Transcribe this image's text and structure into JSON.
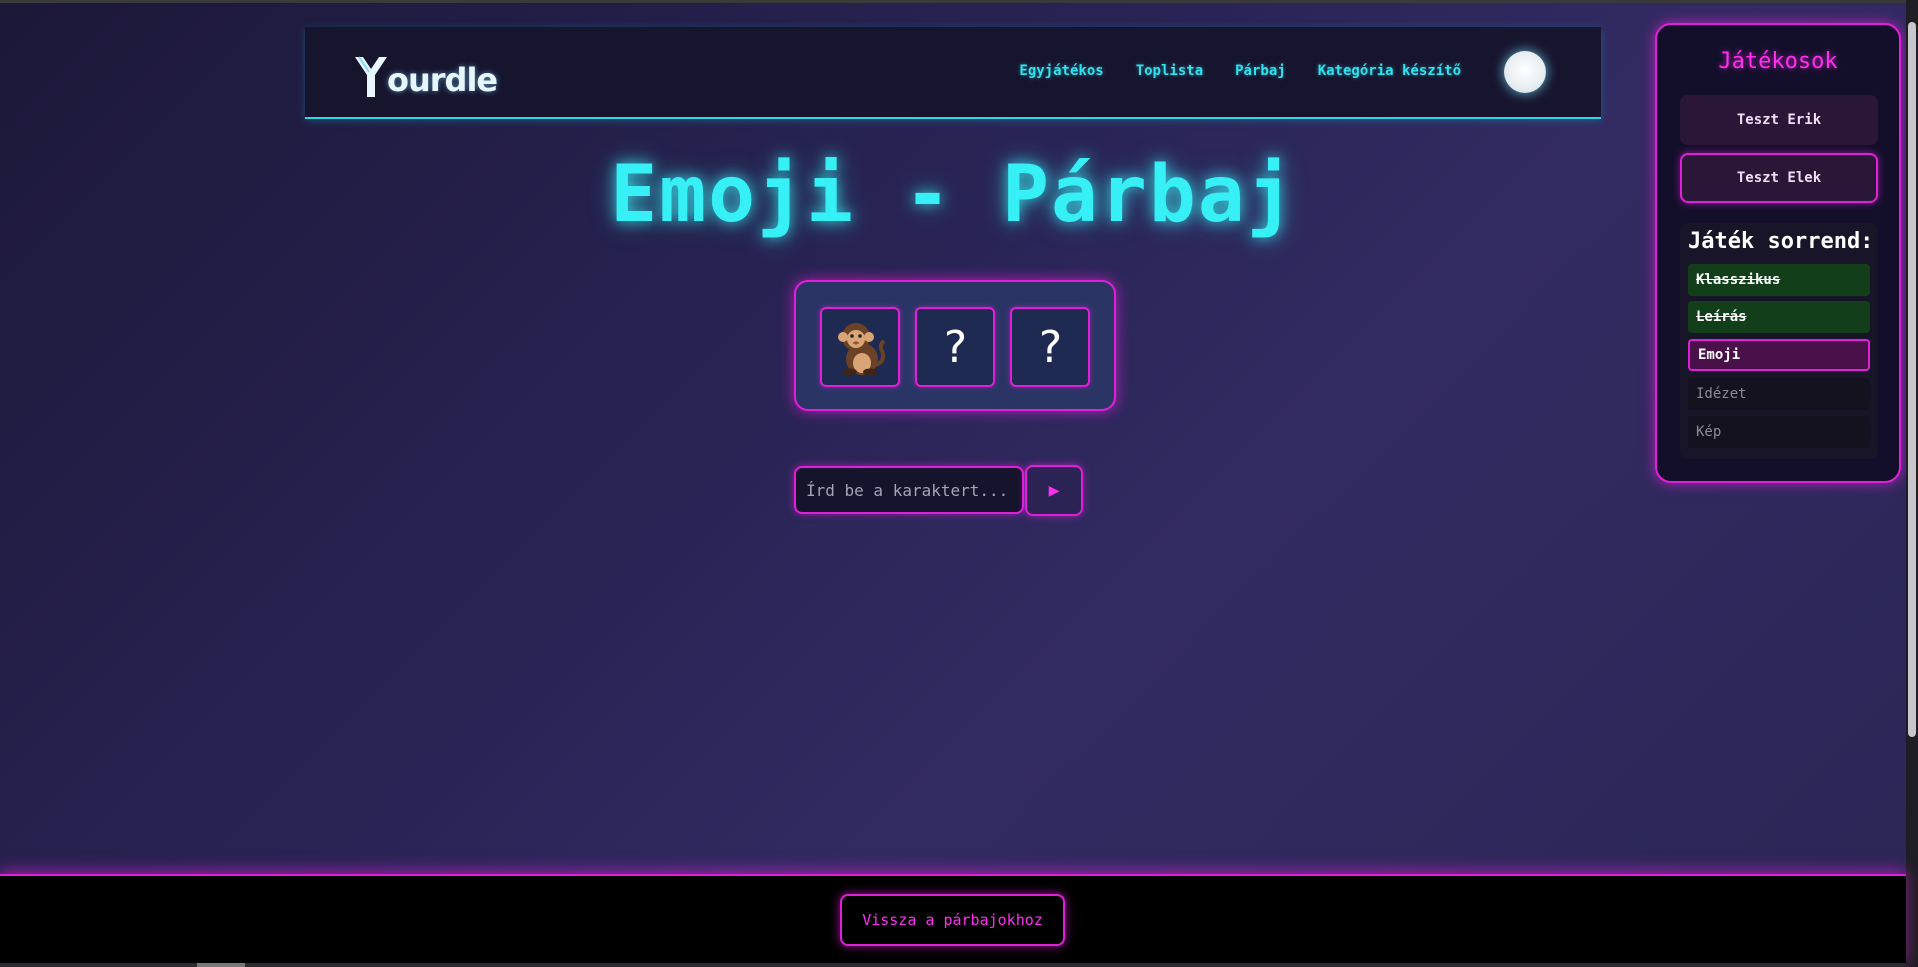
{
  "header": {
    "logo_text": "ourdle",
    "nav": [
      "Egyjátékos",
      "Toplista",
      "Párbaj",
      "Kategória készítő"
    ]
  },
  "main": {
    "title": "Emoji - Párbaj",
    "tiles": [
      {
        "type": "emoji",
        "icon": "monkey-emoji"
      },
      {
        "type": "hidden",
        "text": "?"
      },
      {
        "type": "hidden",
        "text": "?"
      }
    ],
    "input_placeholder": "Írd be a karaktert...",
    "submit_icon": "play-triangle-icon"
  },
  "panel": {
    "title": "Játékosok",
    "players": [
      "Teszt Erik",
      "Teszt Elek"
    ],
    "order_title": "Játék sorrend:",
    "steps": [
      {
        "label": "Klasszikus",
        "status": "done"
      },
      {
        "label": "Leírás",
        "status": "done"
      },
      {
        "label": "Emoji",
        "status": "active"
      },
      {
        "label": "Idézet",
        "status": "pending"
      },
      {
        "label": "Kép",
        "status": "pending"
      }
    ]
  },
  "footer": {
    "back_label": "Vissza a párbajokhoz"
  },
  "colors": {
    "accent_cyan": "#36f0f5",
    "accent_magenta": "#e020d8",
    "done_green": "#123f1a"
  }
}
